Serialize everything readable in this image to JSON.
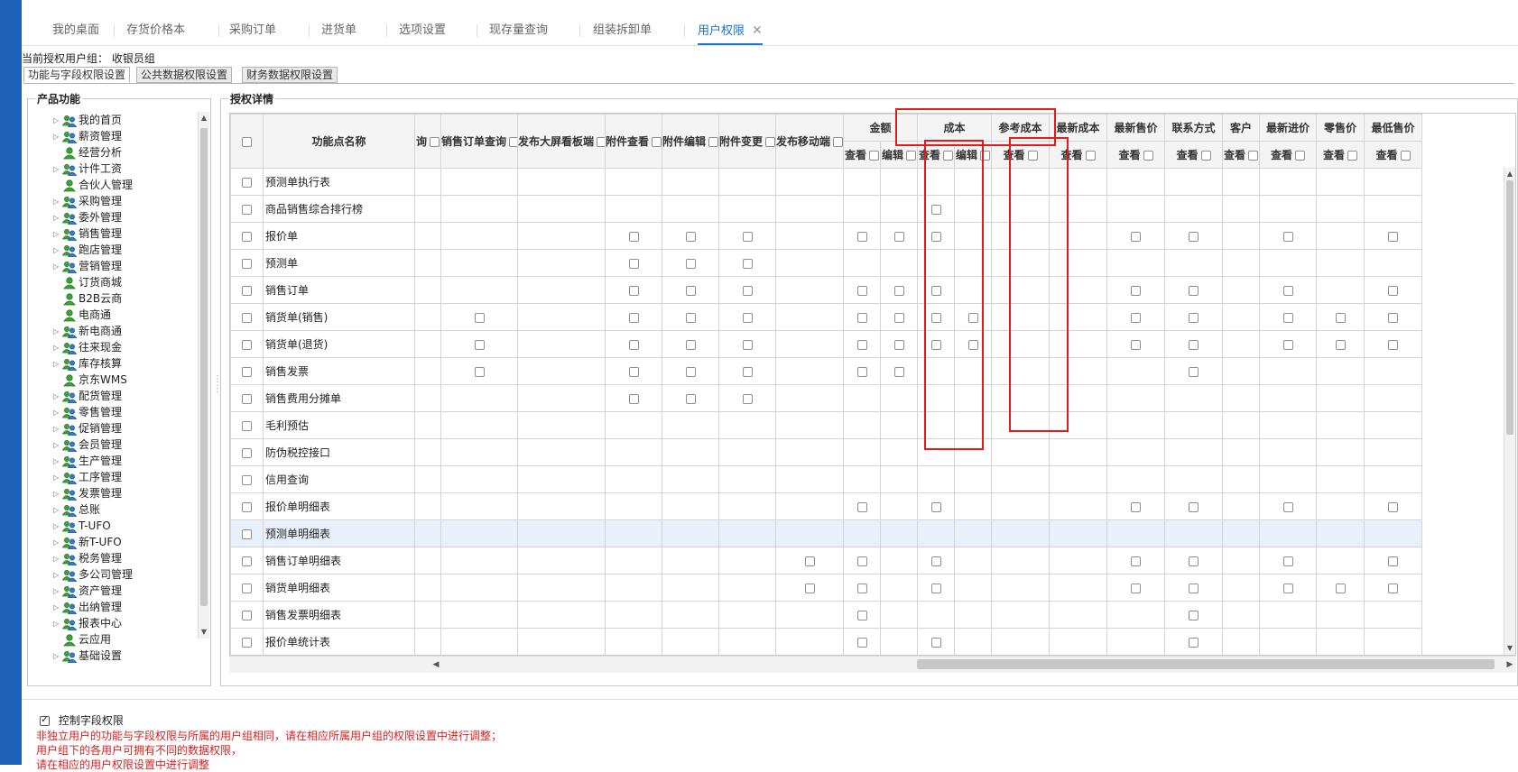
{
  "top_tabs": [
    {
      "label": "我的桌面",
      "active": false
    },
    {
      "label": "存货价格本",
      "active": false
    },
    {
      "label": "采购订单",
      "active": false
    },
    {
      "label": "进货单",
      "active": false
    },
    {
      "label": "选项设置",
      "active": false
    },
    {
      "label": "现存量查询",
      "active": false
    },
    {
      "label": "组装拆卸单",
      "active": false
    },
    {
      "label": "用户权限",
      "active": true
    }
  ],
  "tab_close_glyph": "✕",
  "current_group": {
    "label": "当前授权用户组：",
    "value": "收银员组"
  },
  "sub_tabs": [
    "功能与字段权限设置",
    "公共数据权限设置",
    "财务数据权限设置"
  ],
  "tree_panel_title": "产品功能",
  "tree_items": [
    {
      "label": "我的首页",
      "expandable": true
    },
    {
      "label": "薪资管理",
      "expandable": true
    },
    {
      "label": "经营分析",
      "expandable": false
    },
    {
      "label": "计件工资",
      "expandable": true
    },
    {
      "label": "合伙人管理",
      "expandable": false
    },
    {
      "label": "采购管理",
      "expandable": true
    },
    {
      "label": "委外管理",
      "expandable": true
    },
    {
      "label": "销售管理",
      "expandable": true
    },
    {
      "label": "跑店管理",
      "expandable": true
    },
    {
      "label": "营销管理",
      "expandable": true
    },
    {
      "label": "订货商城",
      "expandable": false
    },
    {
      "label": "B2B云商",
      "expandable": false
    },
    {
      "label": "电商通",
      "expandable": false
    },
    {
      "label": "新电商通",
      "expandable": true
    },
    {
      "label": "往来现金",
      "expandable": true
    },
    {
      "label": "库存核算",
      "expandable": true
    },
    {
      "label": "京东WMS",
      "expandable": false
    },
    {
      "label": "配货管理",
      "expandable": true
    },
    {
      "label": "零售管理",
      "expandable": true
    },
    {
      "label": "促销管理",
      "expandable": true
    },
    {
      "label": "会员管理",
      "expandable": true
    },
    {
      "label": "生产管理",
      "expandable": true
    },
    {
      "label": "工序管理",
      "expandable": true
    },
    {
      "label": "发票管理",
      "expandable": true
    },
    {
      "label": "总账",
      "expandable": true
    },
    {
      "label": "T-UFO",
      "expandable": true
    },
    {
      "label": "新T-UFO",
      "expandable": true
    },
    {
      "label": "税务管理",
      "expandable": true
    },
    {
      "label": "多公司管理",
      "expandable": true
    },
    {
      "label": "资产管理",
      "expandable": true
    },
    {
      "label": "出纳管理",
      "expandable": true
    },
    {
      "label": "报表中心",
      "expandable": true
    },
    {
      "label": "云应用",
      "expandable": false
    },
    {
      "label": "基础设置",
      "expandable": true
    }
  ],
  "detail_panel_title": "授权详情",
  "grid": {
    "name_header": "功能点名称",
    "single_columns": [
      "询",
      "销售订单查询",
      "发布大屏看板端",
      "附件查看",
      "附件编辑",
      "附件变更",
      "发布移动端"
    ],
    "group_columns": [
      {
        "label": "金额",
        "subs": [
          "查看",
          "编辑"
        ]
      },
      {
        "label": "成本",
        "subs": [
          "查看",
          "编辑"
        ]
      },
      {
        "label": "参考成本",
        "subs": [
          "查看"
        ]
      },
      {
        "label": "最新成本",
        "subs": [
          "查看"
        ]
      },
      {
        "label": "最新售价",
        "subs": [
          "查看"
        ]
      },
      {
        "label": "联系方式",
        "subs": [
          "查看"
        ]
      },
      {
        "label": "客户",
        "subs": [
          "查看"
        ]
      },
      {
        "label": "最新进价",
        "subs": [
          "查看"
        ]
      },
      {
        "label": "零售价",
        "subs": [
          "查看"
        ]
      },
      {
        "label": "最低售价",
        "subs": [
          "查看"
        ]
      }
    ],
    "rows": [
      {
        "name": "预测单执行表",
        "cells": [
          0,
          0,
          0,
          0,
          0,
          0,
          0,
          0,
          0,
          0,
          0,
          0,
          0,
          0,
          0,
          0,
          0,
          0,
          0
        ]
      },
      {
        "name": "商品销售综合排行榜",
        "cells": [
          0,
          0,
          0,
          0,
          0,
          0,
          0,
          0,
          0,
          1,
          0,
          0,
          0,
          0,
          0,
          0,
          0,
          0,
          0
        ]
      },
      {
        "name": "报价单",
        "cells": [
          0,
          0,
          0,
          1,
          1,
          1,
          0,
          1,
          1,
          1,
          0,
          0,
          0,
          1,
          1,
          0,
          1,
          0,
          1
        ]
      },
      {
        "name": "预测单",
        "cells": [
          0,
          0,
          0,
          1,
          1,
          1,
          0,
          0,
          0,
          0,
          0,
          0,
          0,
          0,
          0,
          0,
          0,
          0,
          0
        ]
      },
      {
        "name": "销售订单",
        "cells": [
          0,
          0,
          0,
          1,
          1,
          1,
          0,
          1,
          1,
          1,
          0,
          0,
          0,
          1,
          1,
          0,
          1,
          0,
          1
        ]
      },
      {
        "name": "销货单(销售)",
        "cells": [
          0,
          1,
          0,
          1,
          1,
          1,
          0,
          1,
          1,
          1,
          1,
          0,
          0,
          1,
          1,
          0,
          1,
          1,
          1
        ]
      },
      {
        "name": "销货单(退货)",
        "cells": [
          0,
          1,
          0,
          1,
          1,
          1,
          0,
          1,
          1,
          1,
          1,
          0,
          0,
          1,
          1,
          0,
          1,
          1,
          1
        ]
      },
      {
        "name": "销售发票",
        "cells": [
          0,
          1,
          0,
          1,
          1,
          1,
          0,
          1,
          1,
          0,
          0,
          0,
          0,
          0,
          1,
          0,
          0,
          0,
          0
        ]
      },
      {
        "name": "销售费用分摊单",
        "cells": [
          0,
          0,
          0,
          1,
          1,
          1,
          0,
          0,
          0,
          0,
          0,
          0,
          0,
          0,
          0,
          0,
          0,
          0,
          0
        ]
      },
      {
        "name": "毛利预估",
        "cells": [
          0,
          0,
          0,
          0,
          0,
          0,
          0,
          0,
          0,
          0,
          0,
          0,
          0,
          0,
          0,
          0,
          0,
          0,
          0
        ]
      },
      {
        "name": "防伪税控接口",
        "cells": [
          0,
          0,
          0,
          0,
          0,
          0,
          0,
          0,
          0,
          0,
          0,
          0,
          0,
          0,
          0,
          0,
          0,
          0,
          0
        ]
      },
      {
        "name": "信用查询",
        "cells": [
          0,
          0,
          0,
          0,
          0,
          0,
          0,
          0,
          0,
          0,
          0,
          0,
          0,
          0,
          0,
          0,
          0,
          0,
          0
        ]
      },
      {
        "name": "报价单明细表",
        "cells": [
          0,
          0,
          0,
          0,
          0,
          0,
          0,
          1,
          0,
          1,
          0,
          0,
          0,
          1,
          1,
          0,
          1,
          0,
          1
        ]
      },
      {
        "name": "预测单明细表",
        "cells": [
          0,
          0,
          0,
          0,
          0,
          0,
          0,
          0,
          0,
          0,
          0,
          0,
          0,
          0,
          0,
          0,
          0,
          0,
          0
        ],
        "highlight": true
      },
      {
        "name": "销售订单明细表",
        "cells": [
          0,
          0,
          0,
          0,
          0,
          0,
          1,
          1,
          0,
          1,
          0,
          0,
          0,
          1,
          1,
          0,
          1,
          0,
          1
        ]
      },
      {
        "name": "销货单明细表",
        "cells": [
          0,
          0,
          0,
          0,
          0,
          0,
          1,
          1,
          0,
          1,
          0,
          0,
          0,
          1,
          1,
          0,
          1,
          1,
          1
        ]
      },
      {
        "name": "销售发票明细表",
        "cells": [
          0,
          0,
          0,
          0,
          0,
          0,
          0,
          1,
          0,
          0,
          0,
          0,
          0,
          0,
          1,
          0,
          0,
          0,
          0
        ]
      },
      {
        "name": "报价单统计表",
        "cells": [
          0,
          0,
          0,
          0,
          0,
          0,
          0,
          1,
          0,
          1,
          0,
          0,
          0,
          0,
          1,
          0,
          0,
          0,
          0
        ]
      }
    ]
  },
  "bottom": {
    "control_field_label": "控制字段权限",
    "control_field_checked": true,
    "notes": [
      "非独立用户的功能与字段权限与所属的用户组相同，请在相应所属用户组的权限设置中进行调整；",
      "用户组下的各用户可拥有不同的数据权限，",
      "请在相应的用户权限设置中进行调整"
    ]
  },
  "colors": {
    "accent": "#1a73d9",
    "highlight_box": "#e21b1b",
    "note_text": "#d42020",
    "sidebar": "#1e62b8"
  }
}
